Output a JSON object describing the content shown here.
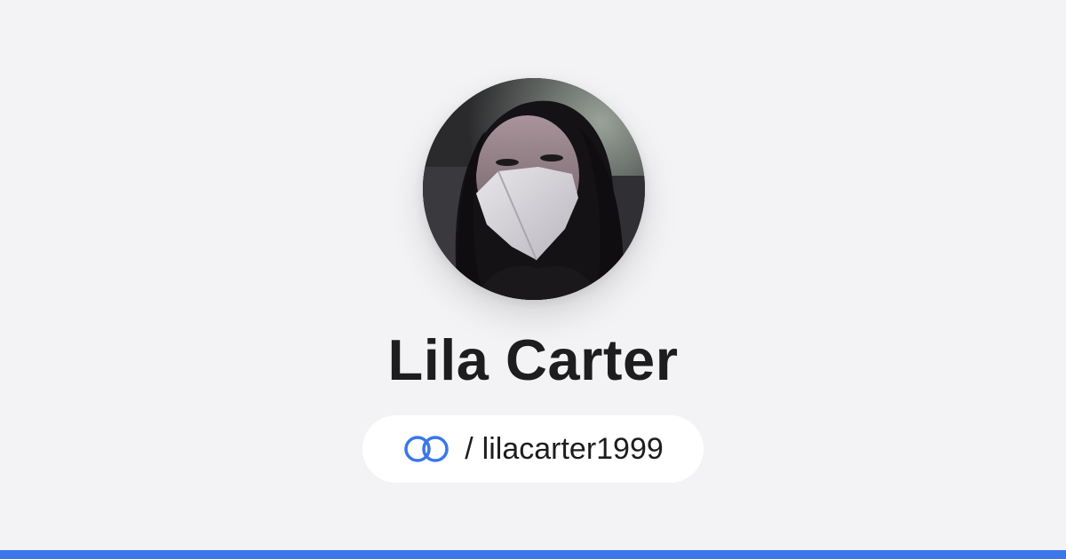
{
  "profile": {
    "name": "Lila Carter",
    "separator": "/",
    "handle": "lilacarter1999",
    "avatar_icon": "profile-photo"
  },
  "brand": {
    "logo_icon": "linked-rings-icon",
    "accent": "#3b76ea"
  },
  "colors": {
    "background": "#f3f3f6",
    "text": "#1d1d20",
    "pill": "#ffffff",
    "bottom_bar": "#3b76ea"
  }
}
